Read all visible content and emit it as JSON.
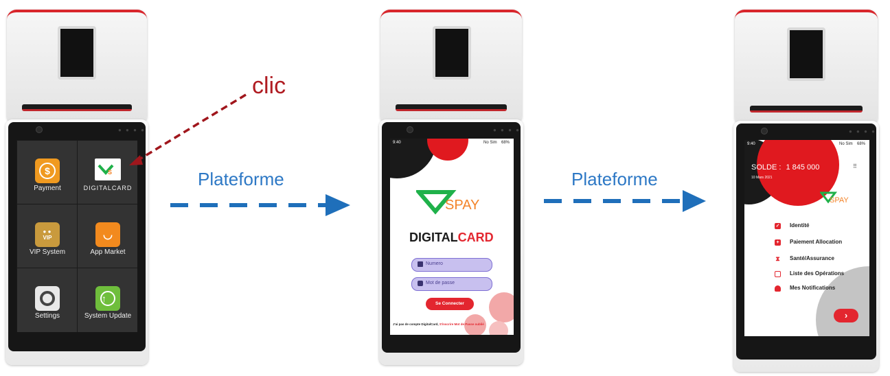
{
  "annotation": {
    "clic": "clic",
    "plateforme_1": "Plateforme",
    "plateforme_2": "Plateforme"
  },
  "colors": {
    "arrow_blue": "#1f6fba",
    "clic_red": "#b01c22",
    "brand_red": "#e3262f",
    "brand_green": "#1fb14a",
    "brand_orange": "#f3842a"
  },
  "launcher": {
    "apps": [
      {
        "label": "Payment",
        "icon": "dollar-icon",
        "color": "#f09a20"
      },
      {
        "label": "DIGITALCARD",
        "icon": "spay-logo-icon",
        "color": "#ffffff"
      },
      {
        "label": "VIP System",
        "icon": "vip-icon",
        "color": "#c99a3d"
      },
      {
        "label": "App Market",
        "icon": "shopping-bag-icon",
        "color": "#f28a1e"
      },
      {
        "label": "Settings",
        "icon": "gear-icon",
        "color": "#8c8c8c"
      },
      {
        "label": "System Update",
        "icon": "upload-icon",
        "color": "#6fbe3c"
      }
    ]
  },
  "login": {
    "status_time": "9:40",
    "status_right": "No Sim",
    "battery": "68%",
    "logo_text": "SPAY",
    "brand_a": "DIGITAL",
    "brand_b": "CARD",
    "username_placeholder": "Numero",
    "password_placeholder": "Mot de passe",
    "login_button": "Se Connecter",
    "footer_text": "J'ai pas de compte DigitalCard,",
    "signup_link": "S'inscrire",
    "forgot_link": "Mot de Passe oublié"
  },
  "dashboard": {
    "status_time": "9:40",
    "status_right": "No Sim",
    "battery": "68%",
    "balance_label": "SOLDE :",
    "balance_value": "1 845 000",
    "date": "10 Mars 2021",
    "logo_text": "SPAY",
    "menu": [
      {
        "label": "Identité",
        "icon": "id-card-icon"
      },
      {
        "label": "Paiement Allocation",
        "icon": "plus-icon"
      },
      {
        "label": "Santé/Assurance",
        "icon": "hourglass-icon"
      },
      {
        "label": "Liste des Opérations",
        "icon": "calendar-icon"
      },
      {
        "label": "Mes Notifications",
        "icon": "bell-icon"
      }
    ],
    "next_button": "›"
  }
}
